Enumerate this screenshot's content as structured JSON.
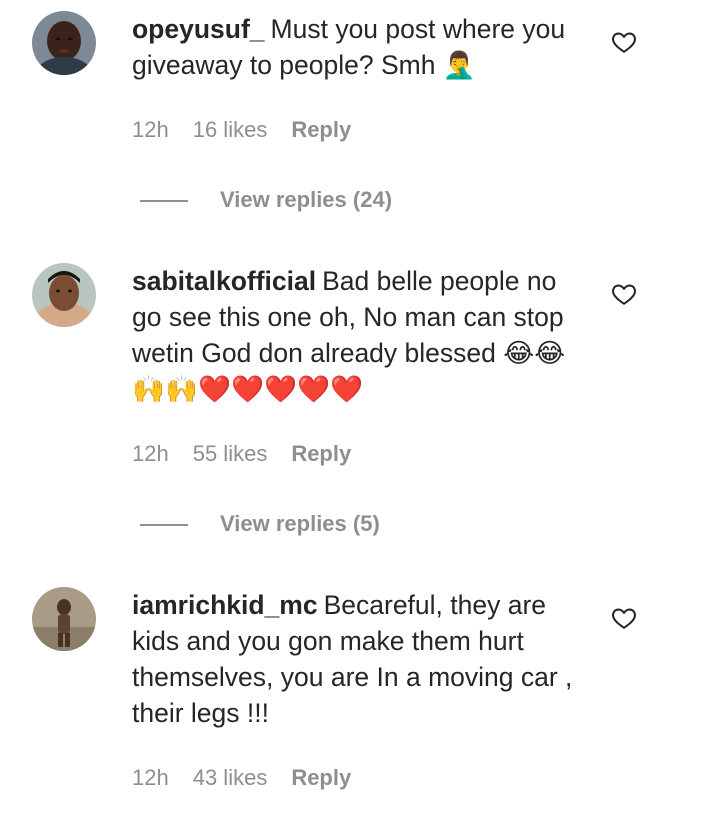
{
  "comments": [
    {
      "username": "opeyusuf_",
      "text": "Must you post where you giveaway to people? Smh 🤦‍♂️",
      "time": "12h",
      "likes": "16 likes",
      "reply_label": "Reply",
      "view_replies": "View replies (24)",
      "avatar_icon": "user-avatar"
    },
    {
      "username": "sabitalkofficial",
      "text": "Bad belle people no go see this one oh, No man can stop wetin God don already blessed 😂😂🙌🙌❤️❤️❤️❤️❤️",
      "time": "12h",
      "likes": "55 likes",
      "reply_label": "Reply",
      "view_replies": "View replies (5)",
      "avatar_icon": "user-avatar"
    },
    {
      "username": "iamrichkid_mc",
      "text": "Becareful, they are kids and you gon make them hurt themselves, you are In a moving car , their legs !!!",
      "time": "12h",
      "likes": "43 likes",
      "reply_label": "Reply",
      "avatar_icon": "user-avatar"
    }
  ],
  "icons": {
    "like": "heart-outline-icon"
  },
  "colors": {
    "text": "#262626",
    "secondary": "#8e8e8e",
    "background": "#ffffff"
  }
}
